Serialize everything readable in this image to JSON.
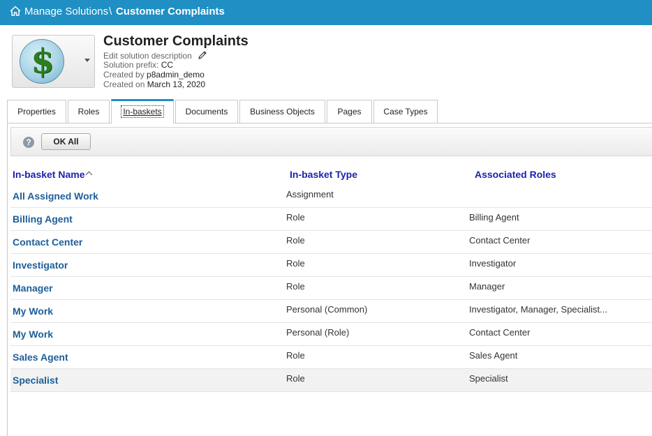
{
  "header": {
    "breadcrumb_root": "Manage Solutions",
    "separator": "\\",
    "breadcrumb_current": "Customer Complaints",
    "accent_color": "#1f8fc4"
  },
  "solution": {
    "title": "Customer Complaints",
    "edit_description": "Edit solution description",
    "prefix_label": "Solution prefix:",
    "prefix_value": "CC",
    "created_by_label": "Created by",
    "created_by_value": "p8admin_demo",
    "created_on_label": "Created on",
    "created_on_value": "March 13, 2020",
    "icon": "dollar-sign-icon"
  },
  "tabs": [
    {
      "label": "Properties",
      "active": false
    },
    {
      "label": "Roles",
      "active": false
    },
    {
      "label": "In-baskets",
      "active": true
    },
    {
      "label": "Documents",
      "active": false
    },
    {
      "label": "Business Objects",
      "active": false
    },
    {
      "label": "Pages",
      "active": false
    },
    {
      "label": "Case Types",
      "active": false
    }
  ],
  "toolbar": {
    "help_glyph": "?",
    "ok_all_label": "OK All"
  },
  "table": {
    "columns": [
      "In-basket Name",
      "In-basket Type",
      "Associated Roles"
    ],
    "sort": "ascending",
    "rows": [
      {
        "name": "All Assigned Work",
        "type": "Assignment",
        "roles": ""
      },
      {
        "name": "Billing Agent",
        "type": "Role",
        "roles": "Billing Agent"
      },
      {
        "name": "Contact Center",
        "type": "Role",
        "roles": "Contact Center"
      },
      {
        "name": "Investigator",
        "type": "Role",
        "roles": "Investigator"
      },
      {
        "name": "Manager",
        "type": "Role",
        "roles": "Manager"
      },
      {
        "name": "My Work",
        "type": "Personal (Common)",
        "roles": "Investigator, Manager, Specialist..."
      },
      {
        "name": "My Work",
        "type": "Personal (Role)",
        "roles": "Contact Center"
      },
      {
        "name": "Sales Agent",
        "type": "Role",
        "roles": "Sales Agent"
      },
      {
        "name": "Specialist",
        "type": "Role",
        "roles": "Specialist"
      }
    ]
  }
}
